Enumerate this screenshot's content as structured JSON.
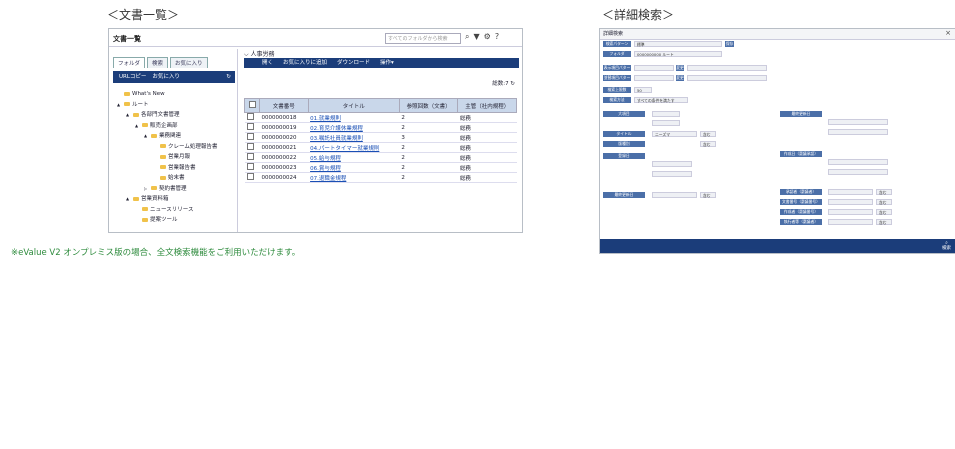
{
  "captions": {
    "left": "＜文書一覧＞",
    "right": "＜詳細検索＞"
  },
  "note": "※eValue V2 オンプレミス版の場合、全文検索機能をご利用いただけます。",
  "doclist": {
    "window_title": "文書一覧",
    "search_placeholder": "すべてのフォルダから検索",
    "tabs": [
      "フォルダ",
      "検索",
      "お気に入り"
    ],
    "left_bar": [
      "URLコピー",
      "お気に入り"
    ],
    "tree": [
      {
        "label": "What's New",
        "indent": 0,
        "expander": ""
      },
      {
        "label": "ルート",
        "indent": 0,
        "expander": "▲"
      },
      {
        "label": "各部門文書管理",
        "indent": 1,
        "expander": "▲"
      },
      {
        "label": "販売企画部",
        "indent": 2,
        "expander": "▲"
      },
      {
        "label": "業務関連",
        "indent": 3,
        "expander": "▲"
      },
      {
        "label": "クレーム処理報告書",
        "indent": 4,
        "expander": ""
      },
      {
        "label": "営業月報",
        "indent": 4,
        "expander": ""
      },
      {
        "label": "営業報告書",
        "indent": 4,
        "expander": ""
      },
      {
        "label": "始末書",
        "indent": 4,
        "expander": ""
      },
      {
        "label": "契約書管理",
        "indent": 3,
        "expander": "▷"
      },
      {
        "label": "営業資料箱",
        "indent": 1,
        "expander": "▲"
      },
      {
        "label": "ニュースリリース",
        "indent": 2,
        "expander": ""
      },
      {
        "label": "提案ツール",
        "indent": 2,
        "expander": ""
      }
    ],
    "breadcrumb": "人事労務",
    "toolbar": [
      "開く",
      "お気に入りに追加",
      "ダウンロード",
      "操作▾"
    ],
    "count": "総数:7",
    "columns": [
      "文書番号",
      "タイトル",
      "参照回数（文書）",
      "主管（社内規程）"
    ],
    "rows": [
      [
        "0000000018",
        "01.就業規則",
        "2",
        "総務"
      ],
      [
        "0000000019",
        "02.育児介護休業規程",
        "2",
        "総務"
      ],
      [
        "0000000020",
        "03.嘱託社員就業規則",
        "3",
        "総務"
      ],
      [
        "0000000021",
        "04.パートタイマー就業規則",
        "2",
        "総務"
      ],
      [
        "0000000022",
        "05.給与規程",
        "2",
        "総務"
      ],
      [
        "0000000023",
        "06.賞与規程",
        "2",
        "総務"
      ],
      [
        "0000000024",
        "07.退職金規程",
        "2",
        "総務"
      ]
    ]
  },
  "detail": {
    "title": "詳細検索",
    "search_button": "検索",
    "labels": {
      "search_pattern": "検索パターン",
      "folder": "フォルダ",
      "display_pattern": "表示項目パターン",
      "sort_pattern": "並替項目パターン",
      "count": "検索上限数",
      "method": "検索方法",
      "big_category": "大項目",
      "title": "タイトル",
      "doc_type": "版種別",
      "register_date": "登録日",
      "keyword": "最終更新日",
      "update_date": "最終更新日",
      "creator": "作成日（稟議承認）",
      "applicant": "承認者（稟議者）",
      "doc_no": "文書番号（稟議番号）",
      "approver": "作成者（稟議番号）",
      "user": "執行者等（稟議者）"
    },
    "values": {
      "search_pattern": "標準",
      "folder_value": "0000000000 ルート",
      "method": "すべての条件を満たす",
      "count": "50",
      "title_value": "ニーズマ",
      "select": "含む",
      "and_or": "含む",
      "save_btn": "保存",
      "change": "変更",
      "choose": "選択"
    }
  }
}
